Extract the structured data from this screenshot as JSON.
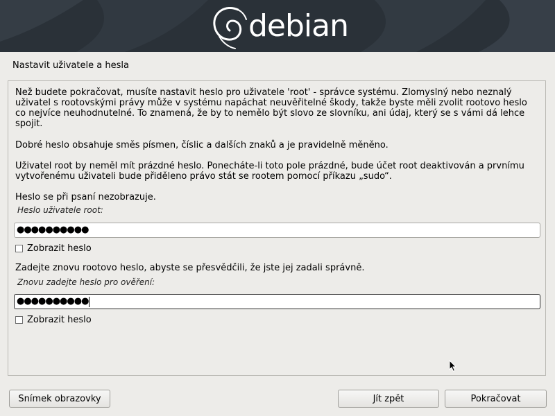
{
  "header": {
    "logo_text": "debian"
  },
  "page": {
    "title": "Nastavit uživatele a hesla"
  },
  "content": {
    "intro": "Než budete pokračovat, musíte nastavit heslo pro uživatele 'root' - správce systému. Zlomyslný nebo neznalý uživatel s rootovskými právy může v systému napáchat neuvěřitelné škody, takže byste měli zvolit rootovo heslo co nejvíce neuhodnutelné. To znamená, že by to nemělo být slovo ze slovníku, ani údaj, který se s vámi dá lehce spojit.",
    "good_password": "Dobré heslo obsahuje směs písmen, číslic a dalších znaků a je pravidelně měněno.",
    "empty_root": "Uživatel root by neměl mít prázdné heslo. Ponecháte-li toto pole prázdné, bude účet root deaktivován a prvnímu vytvořenému uživateli bude přiděleno právo stát se rootem pomocí příkazu „sudo“.",
    "not_shown": "Heslo se při psaní nezobrazuje.",
    "password_label": "Heslo uživatele root:",
    "password_dots": "●●●●●●●●●●",
    "show_password_1": "Zobrazit heslo",
    "reenter_prompt": "Zadejte znovu rootovo heslo, abyste se přesvědčili, že jste jej zadali správně.",
    "verify_label": "Znovu zadejte heslo pro ověření:",
    "verify_dots": "●●●●●●●●●●",
    "show_password_2": "Zobrazit heslo"
  },
  "footer": {
    "screenshot_button": "Snímek obrazovky",
    "back_button": "Jít zpět",
    "continue_button": "Pokračovat"
  },
  "checkboxes": {
    "show_password_1": false,
    "show_password_2": false
  }
}
